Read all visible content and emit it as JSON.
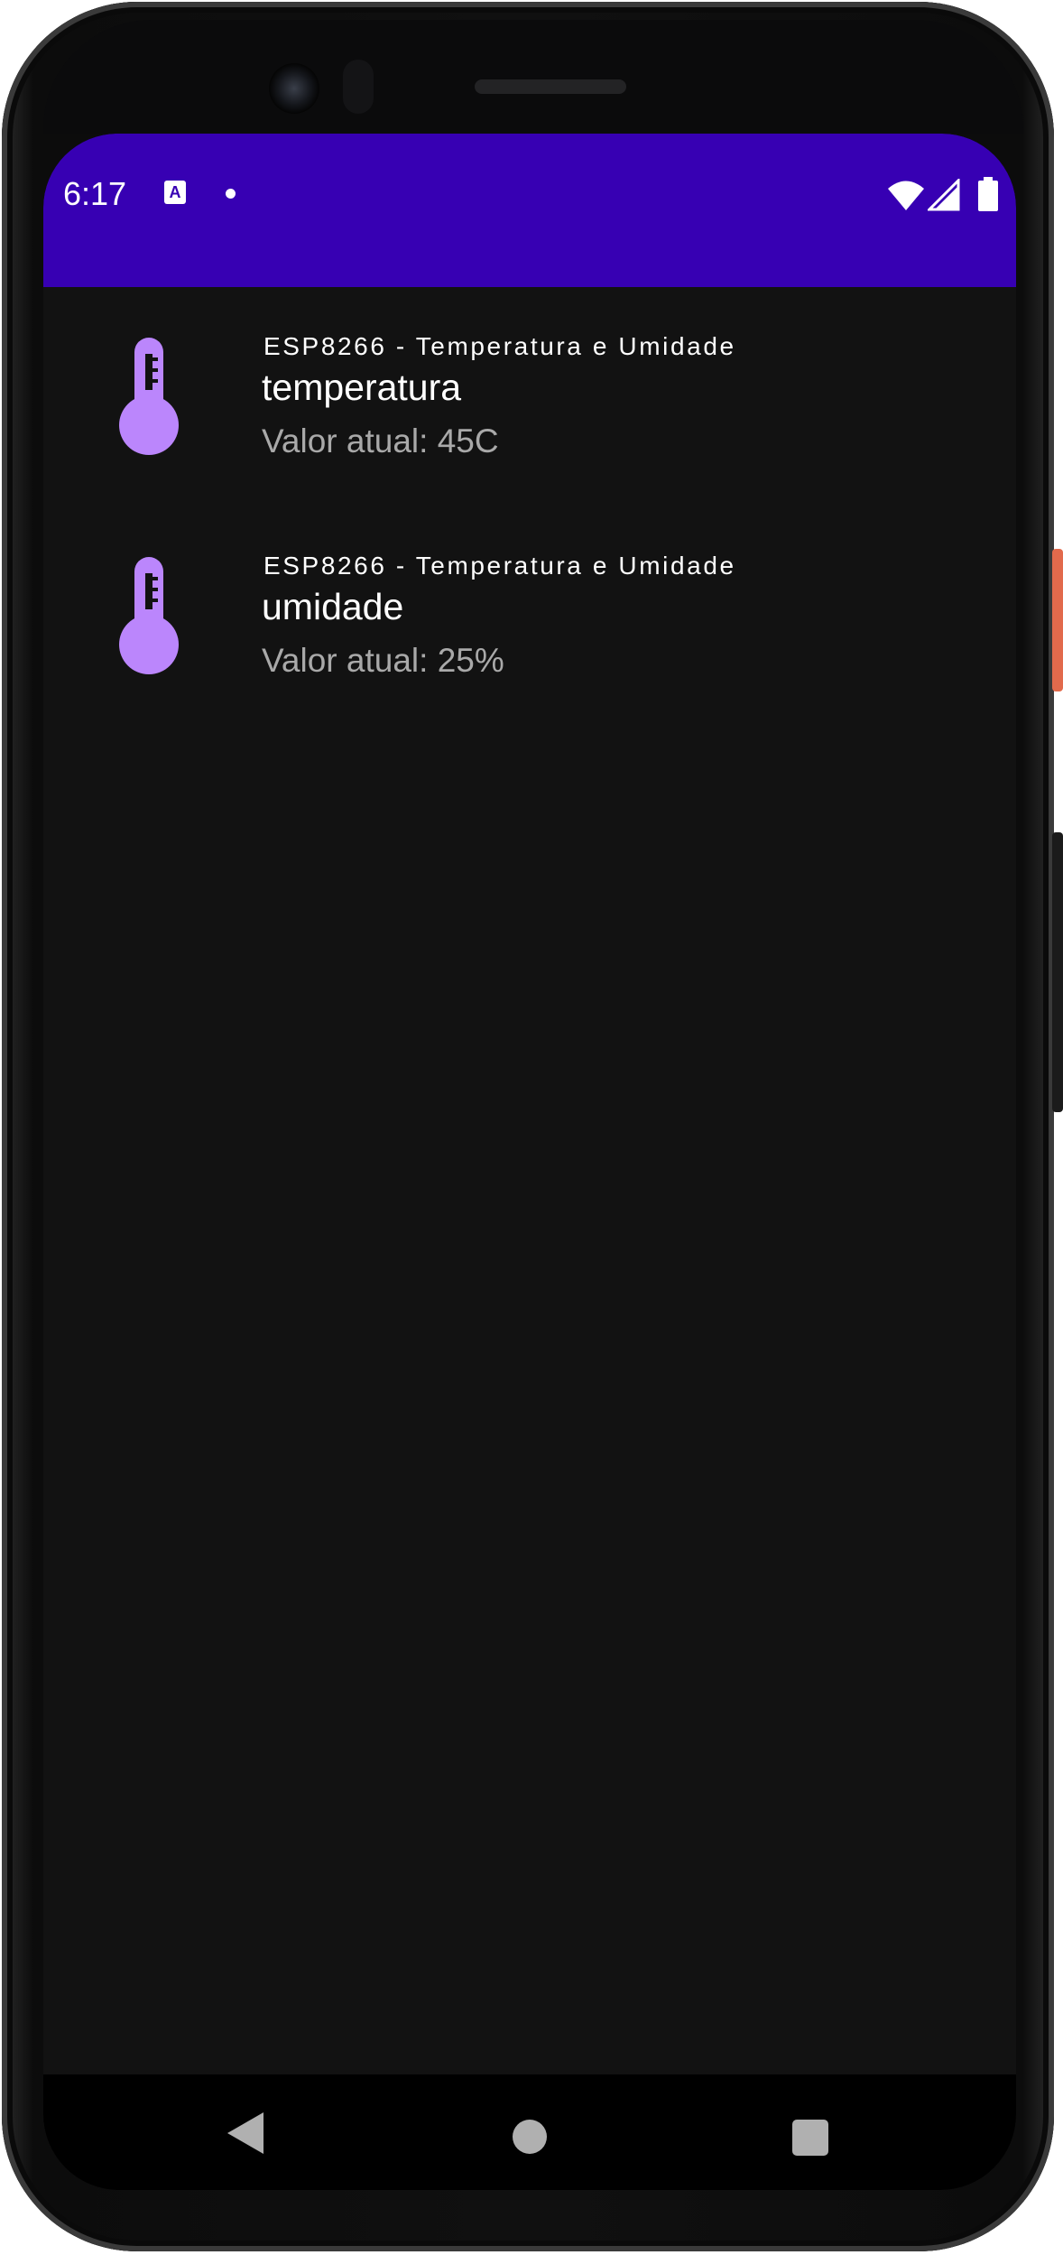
{
  "status_bar": {
    "time": "6:17",
    "notification_icons": [
      "accessibility-a-icon",
      "dot-icon"
    ],
    "system_icons": [
      "wifi-icon",
      "signal-icon",
      "battery-icon"
    ],
    "color": "#3700b3"
  },
  "sensors": [
    {
      "icon": "thermometer-icon",
      "device": "ESP8266 - Temperatura e Umidade",
      "name": "temperatura",
      "value": "Valor atual: 45C"
    },
    {
      "icon": "thermometer-icon",
      "device": "ESP8266 - Temperatura e Umidade",
      "name": "umidade",
      "value": "Valor atual: 25%"
    }
  ],
  "colors": {
    "background": "#121212",
    "icon_accent": "#bb86fc",
    "secondary_text": "#a9a9a9"
  },
  "nav_bar": {
    "buttons": [
      "back-icon",
      "home-icon",
      "recents-icon"
    ]
  }
}
